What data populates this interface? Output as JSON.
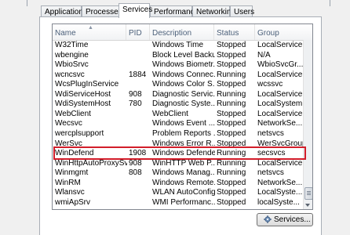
{
  "tabs": [
    "Applications",
    "Processes",
    "Services",
    "Performance",
    "Networking",
    "Users"
  ],
  "active_tab": "Services",
  "columns": [
    "Name",
    "PID",
    "Description",
    "Status",
    "Group"
  ],
  "rows": [
    [
      "W32Time",
      "",
      "Windows Time",
      "Stopped",
      "LocalService"
    ],
    [
      "wbengine",
      "",
      "Block Level Backu...",
      "Stopped",
      "N/A"
    ],
    [
      "WbioSrvc",
      "",
      "Windows Biometr...",
      "Stopped",
      "WbioSvcGr..."
    ],
    [
      "wcncsvc",
      "1884",
      "Windows Connec...",
      "Running",
      "LocalService..."
    ],
    [
      "WcsPlugInService",
      "",
      "Windows Color S...",
      "Stopped",
      "wcssvc"
    ],
    [
      "WdiServiceHost",
      "908",
      "Diagnostic Servic...",
      "Running",
      "LocalService"
    ],
    [
      "WdiSystemHost",
      "780",
      "Diagnostic Syste...",
      "Running",
      "LocalSystem..."
    ],
    [
      "WebClient",
      "",
      "WebClient",
      "Stopped",
      "LocalService"
    ],
    [
      "Wecsvc",
      "",
      "Windows Event ...",
      "Stopped",
      "NetworkSe..."
    ],
    [
      "wercplsupport",
      "",
      "Problem Reports ...",
      "Stopped",
      "netsvcs"
    ],
    [
      "WerSvc",
      "",
      "Windows Error R...",
      "Stopped",
      "WerSvcGroup"
    ],
    [
      "WinDefend",
      "1908",
      "Windows Defender",
      "Running",
      "secsvcs"
    ],
    [
      "WinHttpAutoProxySvc",
      "908",
      "WinHTTP Web P...",
      "Running",
      "LocalService"
    ],
    [
      "Winmgmt",
      "808",
      "Windows Manag...",
      "Running",
      "netsvcs"
    ],
    [
      "WinRM",
      "",
      "Windows Remote...",
      "Stopped",
      "NetworkSe..."
    ],
    [
      "Wlansvc",
      "",
      "WLAN AutoConfig",
      "Stopped",
      "LocalSyste..."
    ],
    [
      "wmiApSrv",
      "",
      "WMI Performanc...",
      "Stopped",
      "localSyste..."
    ]
  ],
  "highlighted_row": "WinDefend",
  "highlight_color": "#d21d2a",
  "services_button": "Services..."
}
